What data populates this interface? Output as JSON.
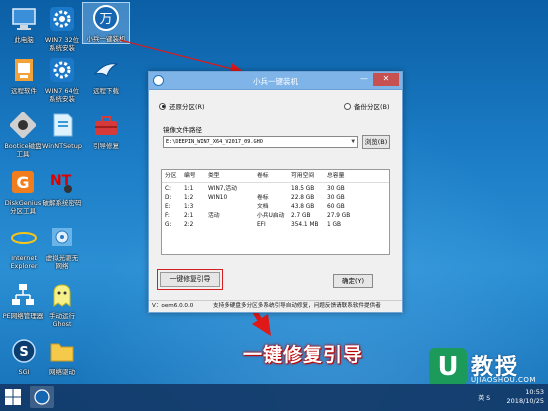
{
  "desktop": {
    "icons": [
      {
        "label": "此电脑",
        "icon": "computer-icon"
      },
      {
        "label": "WIN7 32位\n系统安装",
        "icon": "gear-icon"
      },
      {
        "label": "小兵一键装机",
        "icon": "installer-icon"
      },
      {
        "label": "远程软件",
        "icon": "remote-icon"
      },
      {
        "label": "WIN7 64位\n系统安装",
        "icon": "gear-icon"
      },
      {
        "label": "远程下载",
        "icon": "bird-icon"
      },
      {
        "label": "Bootice磁盘\n工具",
        "icon": "bootice-icon"
      },
      {
        "label": "WinNTSetup",
        "icon": "setup-icon"
      },
      {
        "label": "引导修复",
        "icon": "toolbox-icon"
      },
      {
        "label": "DiskGenius\n分区工具",
        "icon": "diskgenius-icon"
      },
      {
        "label": "破解系统密码",
        "icon": "nt-password-icon"
      },
      {
        "label": "Internet\nExplorer",
        "icon": "ie-icon"
      },
      {
        "label": "虚拟光驱无\n网络",
        "icon": "virtual-drive-icon"
      },
      {
        "label": "PE网络管理器",
        "icon": "network-icon"
      },
      {
        "label": "手动运行\nGhost",
        "icon": "ghost-icon"
      },
      {
        "label": "SGI",
        "icon": "sgi-icon"
      },
      {
        "label": "网络驱动",
        "icon": "folder-icon"
      }
    ]
  },
  "dialog": {
    "title": "小兵一键装机",
    "minimize": "—",
    "close": "✕",
    "radio_restore": "还原分区(R)",
    "radio_backup": "备份分区(B)",
    "image_path_label": "镜像文件路径",
    "image_path": "E:\\DEEPIN_WIN7_X64_V2017_09.GHO",
    "browse": "浏览(B)",
    "table": {
      "headers": [
        "分区",
        "编号",
        "类型",
        "卷标",
        "可用空间",
        "总容量"
      ],
      "rows": [
        [
          "C:",
          "1:1",
          "WIN7,活动",
          "",
          "18.5 GB",
          "30 GB"
        ],
        [
          "D:",
          "1:2",
          "WIN10",
          "卷标",
          "22.8 GB",
          "30 GB"
        ],
        [
          "E:",
          "1:3",
          "",
          "文档",
          "43.8 GB",
          "60 GB"
        ],
        [
          "F:",
          "2:1",
          "活动",
          "小兵U启动",
          "2.7 GB",
          "27.9 GB"
        ],
        [
          "G:",
          "2:2",
          "",
          "EFI",
          "354.1 MB",
          "1 GB"
        ]
      ]
    },
    "repair_button": "一键修复引导",
    "ok_button": "确定(Y)",
    "status_version": "V：oem6.0.0.0",
    "status_message": "支持多硬盘多分区多系统引导自动修复，问题反馈请联系软件提供者"
  },
  "caption": "一键修复引导",
  "watermark": {
    "logo_letter": "U",
    "title": "教授",
    "site": "UJIAOSHOU.COM"
  },
  "taskbar": {
    "ime": "英 S",
    "time": "10:53",
    "date": "2018/10/25"
  },
  "colors": {
    "accent_red": "#d42020",
    "title_bar": "#7fb4e8",
    "watermark_green": "#1b9a59"
  }
}
